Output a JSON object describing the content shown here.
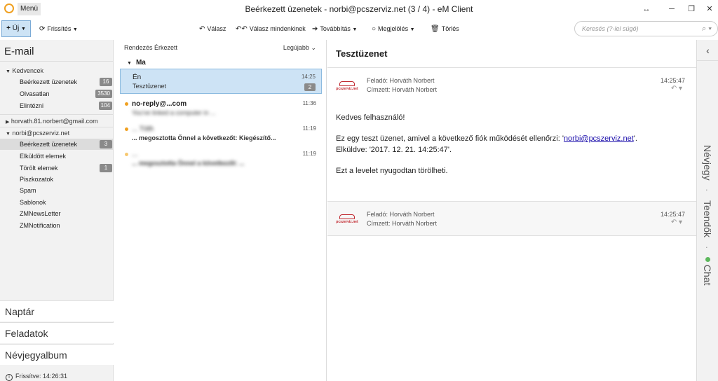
{
  "titlebar": {
    "menu_label": "Menü",
    "title": "Beérkezett üzenetek - norbi@pcszerviz.net (3 / 4) - eM Client",
    "restore_icon": "↔",
    "minimize_icon": "─",
    "maximize_icon": "❐",
    "close_icon": "✕"
  },
  "toolbar": {
    "new_label": "Új",
    "refresh_label": "Frissítés",
    "reply_label": "Válasz",
    "reply_all_label": "Válasz mindenkinek",
    "forward_label": "Továbbítás",
    "mark_label": "Megjelölés",
    "delete_label": "Törlés",
    "search_placeholder": "Keresés (?-lel súgó)"
  },
  "sidebar": {
    "section_title": "E-mail",
    "favorites": {
      "label": "Kedvencek",
      "items": [
        {
          "label": "Beérkezett üzenetek",
          "count": "16"
        },
        {
          "label": "Olvasatlan",
          "count": "3530"
        },
        {
          "label": "Elintézni",
          "count": "104"
        }
      ]
    },
    "account1": {
      "label": "horvath.81.norbert@gmail.com"
    },
    "account2": {
      "label": "norbi@pcszerviz.net",
      "items": [
        {
          "label": "Beérkezett üzenetek",
          "count": "3"
        },
        {
          "label": "Elküldött elemek",
          "count": ""
        },
        {
          "label": "Törölt elemek",
          "count": "1"
        },
        {
          "label": "Piszkozatok",
          "count": ""
        },
        {
          "label": "Spam",
          "count": ""
        },
        {
          "label": "Sablonok",
          "count": ""
        },
        {
          "label": "ZMNewsLetter",
          "count": ""
        },
        {
          "label": "ZMNotification",
          "count": ""
        }
      ]
    },
    "nav": {
      "calendar": "Naptár",
      "tasks": "Feladatok",
      "contacts": "Névjegyalbum"
    },
    "status": "Frissítve: 14:26:31"
  },
  "msglist": {
    "sort_label": "Rendezés Érkezett",
    "sort_order": "Legújabb",
    "group_today": "Ma",
    "messages": [
      {
        "sender": "Én",
        "subject": "Tesztüzenet",
        "time": "14:25",
        "count": "2"
      },
      {
        "sender": "no-reply@...com",
        "subject": "You've linked a computer in ...",
        "time": "11:36"
      },
      {
        "sender": "... Tóth",
        "subject": "... megosztotta Önnel a következőt: Kiegészítő...",
        "time": "11:19"
      },
      {
        "sender": "...",
        "subject": "... megosztotta Önnel a következőt: ...",
        "time": "11:19"
      }
    ]
  },
  "reading": {
    "subject": "Tesztüzenet",
    "logo_text": "pcszerviz.net",
    "mail1": {
      "from": "Feladó: Horváth Norbert",
      "to": "Címzett: Horváth Norbert",
      "time": "14:25:47"
    },
    "body": {
      "greeting": "Kedves felhasználó!",
      "line1_before": "Ez egy teszt üzenet, amivel a következő fiók működését ellenőrzi: '",
      "line1_link": "norbi@pcszerviz.net",
      "line1_after": "'.",
      "line2": "Elküldve: '2017. 12. 21. 14:25:47'.",
      "line3": "Ezt a levelet nyugodtan törölheti."
    },
    "mail2": {
      "from": "Feladó: Horváth Norbert",
      "to": "Címzett: Horváth Norbert",
      "time": "14:25:47"
    }
  },
  "rightbar": {
    "collapse_icon": "‹",
    "tab_contacts": "Névjegy",
    "tab_todos": "Teendők",
    "tab_chat": "Chat",
    "separator": "·"
  }
}
